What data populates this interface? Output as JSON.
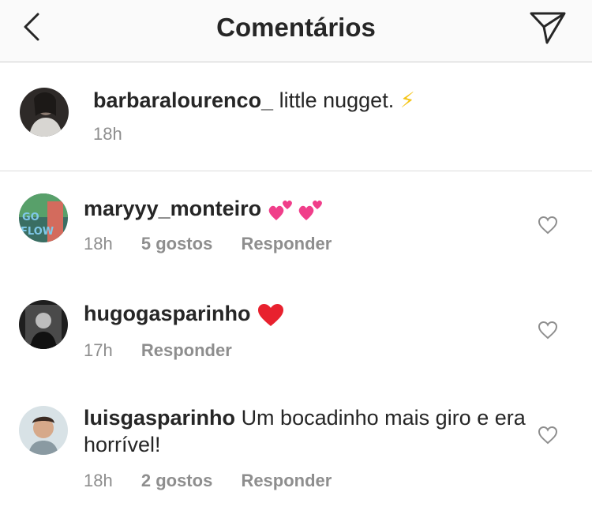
{
  "header": {
    "title": "Comentários",
    "back_icon": "chevron-left-icon",
    "send_icon": "paper-plane-icon"
  },
  "caption": {
    "username": "barbaralourenco_",
    "text": "little nugget.",
    "emoji": "⚡",
    "time": "18h"
  },
  "comments": [
    {
      "username": "maryyy_monteiro",
      "text": "",
      "emoji": "💕 💕",
      "time": "18h",
      "likes": "5 gostos",
      "reply": "Responder"
    },
    {
      "username": "hugogasparinho",
      "text": "",
      "emoji": "❤️",
      "time": "17h",
      "likes": "",
      "reply": "Responder"
    },
    {
      "username": "luisgasparinho",
      "text": "Um bocadinho mais giro e era horrível!",
      "emoji": "",
      "time": "18h",
      "likes": "2 gostos",
      "reply": "Responder"
    }
  ],
  "colors": {
    "primary_text": "#262626",
    "secondary_text": "#8e8e8e",
    "heart_red": "#ed4956",
    "divider": "#dbdbdb"
  }
}
